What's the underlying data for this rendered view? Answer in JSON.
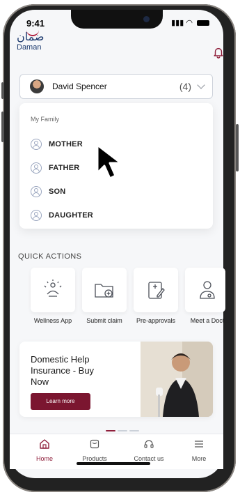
{
  "status_bar": {
    "time": "9:41"
  },
  "brand": {
    "arabic": "ضمان",
    "english": "Daman"
  },
  "user_selector": {
    "name": "David Spencer",
    "count": "(4)"
  },
  "family": {
    "title": "My Family",
    "members": [
      "MOTHER",
      "FATHER",
      "SON",
      "DAUGHTER"
    ]
  },
  "quick_actions": {
    "title": "QUICK ACTIONS",
    "items": [
      {
        "label": "Wellness App",
        "icon": "wellness-icon"
      },
      {
        "label": "Submit claim",
        "icon": "folder-plus-icon"
      },
      {
        "label": "Pre-approvals",
        "icon": "clipboard-icon"
      },
      {
        "label": "Meet a Doctor",
        "icon": "doctor-icon"
      }
    ]
  },
  "promo": {
    "title": "Domestic Help Insurance - Buy Now",
    "button": "Learn more"
  },
  "tabs": [
    {
      "label": "Home",
      "icon": "home-icon",
      "active": true
    },
    {
      "label": "Products",
      "icon": "products-icon",
      "active": false
    },
    {
      "label": "Contact us",
      "icon": "headset-icon",
      "active": false
    },
    {
      "label": "More",
      "icon": "menu-icon",
      "active": false
    }
  ],
  "colors": {
    "brand": "#8f1f3b",
    "brand_blue": "#1c3a6e"
  }
}
